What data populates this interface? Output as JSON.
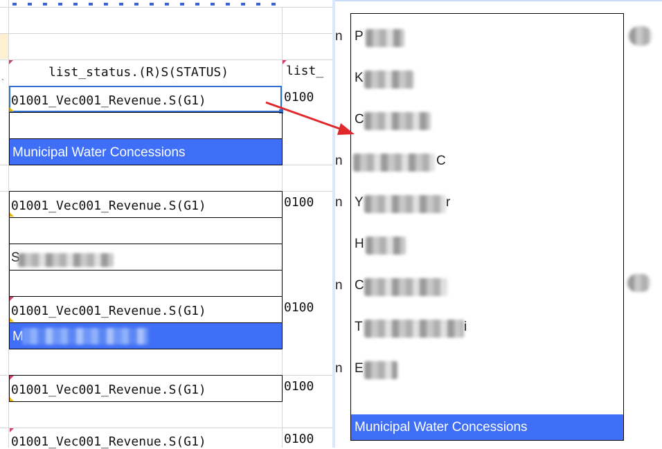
{
  "sheet": {
    "header_label": "list_status.(R)S(STATUS)",
    "header_label_right": "list_",
    "revenue_codes": [
      "01001_Vec001_Revenue.S(G1)",
      "01001_Vec001_Revenue.S(G1)",
      "01001_Vec001_Revenue.S(G1)",
      "01001_Vec001_Revenue.S(G1)",
      "01001_Vec001_Revenue.S(G1)"
    ],
    "right_codes": [
      "0100",
      "0100",
      "0100",
      "0100",
      "0100"
    ],
    "selected_value": "Municipal Water Concessions",
    "blurred_first_letters": [
      "S",
      "M"
    ]
  },
  "dropdown": {
    "items": [
      {
        "visible_start": "P",
        "visible_end": ""
      },
      {
        "visible_start": "K",
        "visible_end": ""
      },
      {
        "visible_start": "C",
        "visible_end": ""
      },
      {
        "visible_start": "",
        "visible_end": "C"
      },
      {
        "visible_start": "Y",
        "visible_end": "r"
      },
      {
        "visible_start": "H",
        "visible_end": ""
      },
      {
        "visible_start": "C",
        "visible_end": ""
      },
      {
        "visible_start": "T",
        "visible_end": "i"
      },
      {
        "visible_start": "E",
        "visible_end": ""
      }
    ],
    "selected_item": "Municipal Water Concessions"
  },
  "left_edge_letters": [
    "n",
    "n",
    "n",
    "n",
    "n"
  ],
  "colors": {
    "selection_blue": "#3f6ff6",
    "arrow_red": "#e0282c",
    "active_cell_border": "#2f6fd1"
  }
}
